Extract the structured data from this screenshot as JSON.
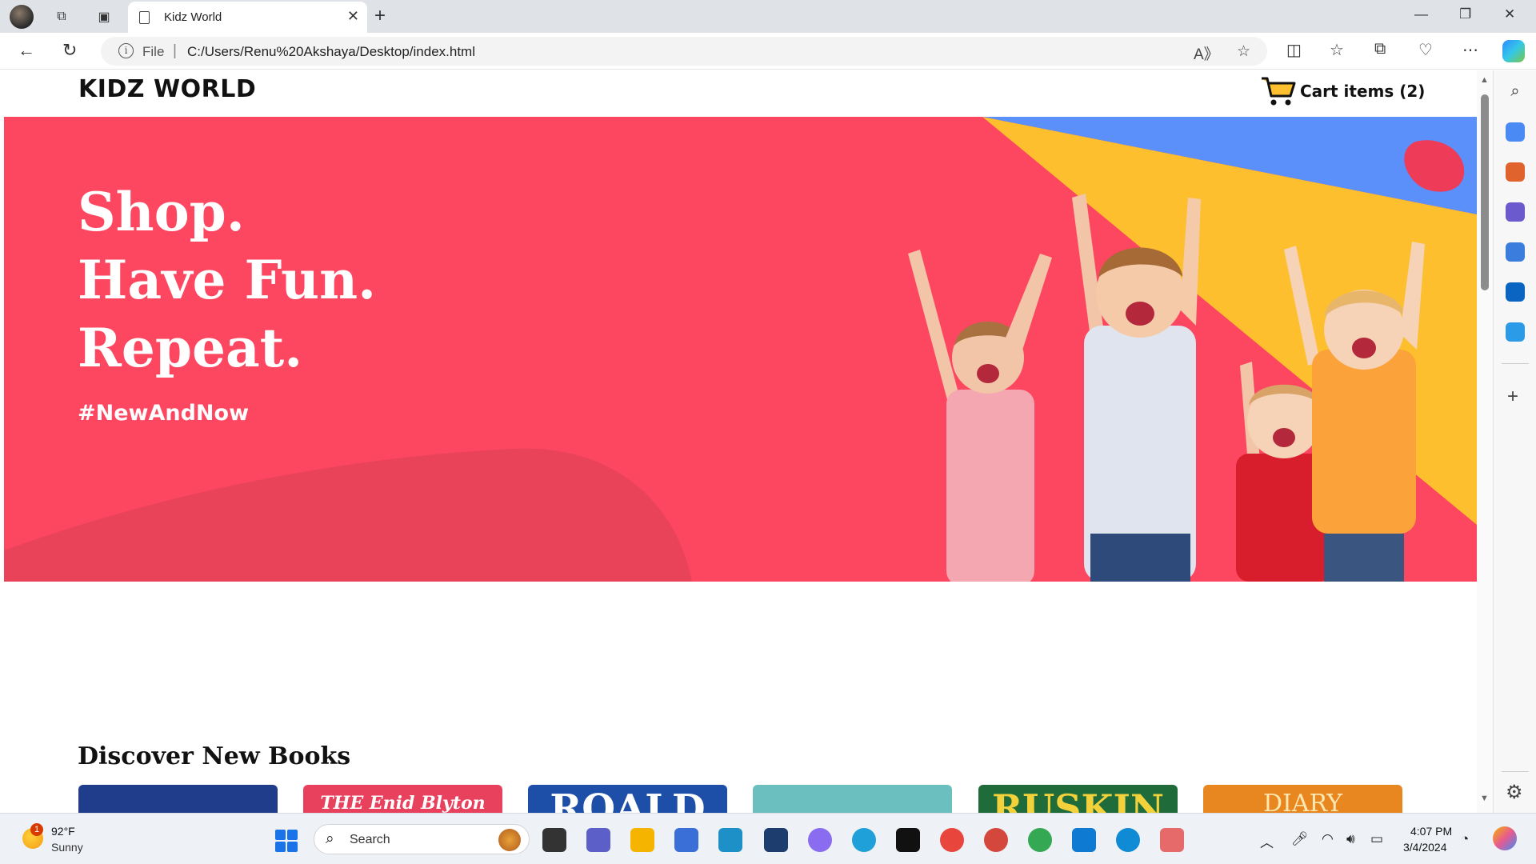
{
  "browser": {
    "tab_title": "Kidz World",
    "address_scheme": "File",
    "address_url": "C:/Users/Renu%20Akshaya/Desktop/index.html"
  },
  "site": {
    "logo": "KIDZ WORLD",
    "cart_label": "Cart items (2)",
    "hero_lines": [
      "Shop.",
      "Have Fun.",
      "Repeat."
    ],
    "hero_tag": "#NewAndNow",
    "discover_title": "Discover New Books",
    "book_covers": [
      {
        "text": "...",
        "bg": "#1f3d8a",
        "fg": "#ffffff"
      },
      {
        "text": "THE Enid Blyton",
        "bg": "#e8415e",
        "fg": "#ffffff"
      },
      {
        "text": "ROALD",
        "bg": "#1e4fa8",
        "fg": "#ffffff"
      },
      {
        "text": "...",
        "bg": "#6bbfbe",
        "fg": "#1a3b3a"
      },
      {
        "text": "RUSKIN",
        "bg": "#1f6b3a",
        "fg": "#f2d13a"
      },
      {
        "text": "DIARY",
        "bg": "#e8861f",
        "fg": "#fbe7b0"
      }
    ],
    "colors": {
      "hero_bg": "#fd4660",
      "accent_blue": "#5b8ff9",
      "accent_yellow": "#fdbf2d"
    }
  },
  "taskbar": {
    "weather_temp": "92°F",
    "weather_desc": "Sunny",
    "weather_badge": "1",
    "search_label": "Search",
    "time": "4:07 PM",
    "date": "3/4/2024"
  }
}
